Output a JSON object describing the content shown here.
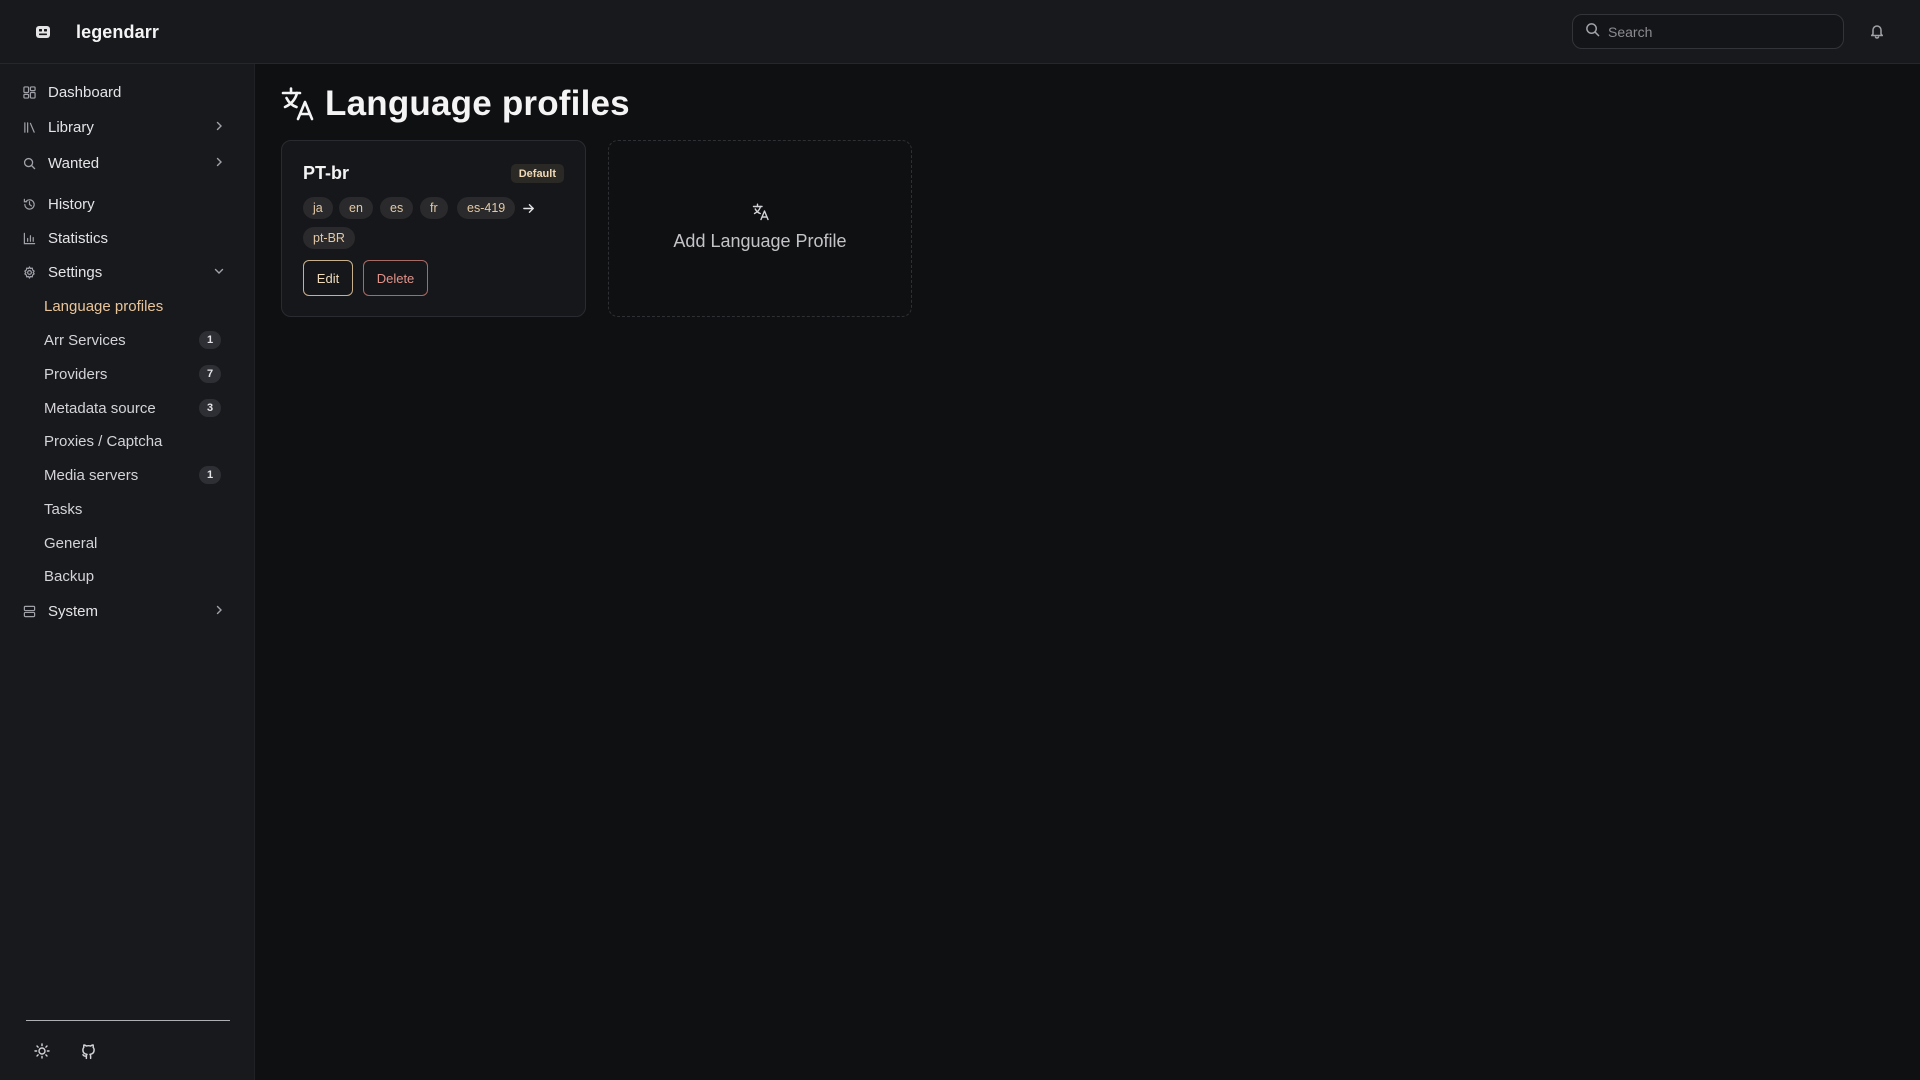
{
  "app": {
    "name": "legendarr"
  },
  "header": {
    "search": {
      "placeholder": "Search",
      "value": ""
    }
  },
  "sidebar": {
    "items": [
      {
        "label": "Dashboard",
        "icon": "dashboard-icon"
      },
      {
        "label": "Library",
        "icon": "library-icon",
        "chevron": "right"
      },
      {
        "label": "Wanted",
        "icon": "search-icon",
        "chevron": "right"
      },
      {
        "label": "History",
        "icon": "history-icon"
      },
      {
        "label": "Statistics",
        "icon": "bar-chart-icon"
      },
      {
        "label": "Settings",
        "icon": "gear-icon",
        "chevron": "down"
      },
      {
        "label": "System",
        "icon": "server-icon",
        "chevron": "right"
      }
    ],
    "settings_children": [
      {
        "label": "Language profiles",
        "active": true
      },
      {
        "label": "Arr Services",
        "count": "1"
      },
      {
        "label": "Providers",
        "count": "7"
      },
      {
        "label": "Metadata source",
        "count": "3"
      },
      {
        "label": "Proxies / Captcha"
      },
      {
        "label": "Media servers",
        "count": "1"
      },
      {
        "label": "Tasks"
      },
      {
        "label": "General"
      },
      {
        "label": "Backup"
      }
    ],
    "footer_icons": [
      "sun-icon",
      "github-icon"
    ]
  },
  "main": {
    "title": "Language profiles",
    "title_icon": "translate-icon",
    "profiles": [
      {
        "name": "PT-br",
        "badge": "Default",
        "source_languages": [
          "ja",
          "en",
          "es",
          "fr",
          "es-419"
        ],
        "target_language": "pt-BR",
        "edit_label": "Edit",
        "delete_label": "Delete"
      }
    ],
    "add_card": {
      "label": "Add Language Profile",
      "icon": "translate-icon"
    }
  },
  "colors": {
    "background": "#0f1012",
    "sidebar": "#18191c",
    "accent": "#e8c49a",
    "danger": "#e0938a"
  }
}
